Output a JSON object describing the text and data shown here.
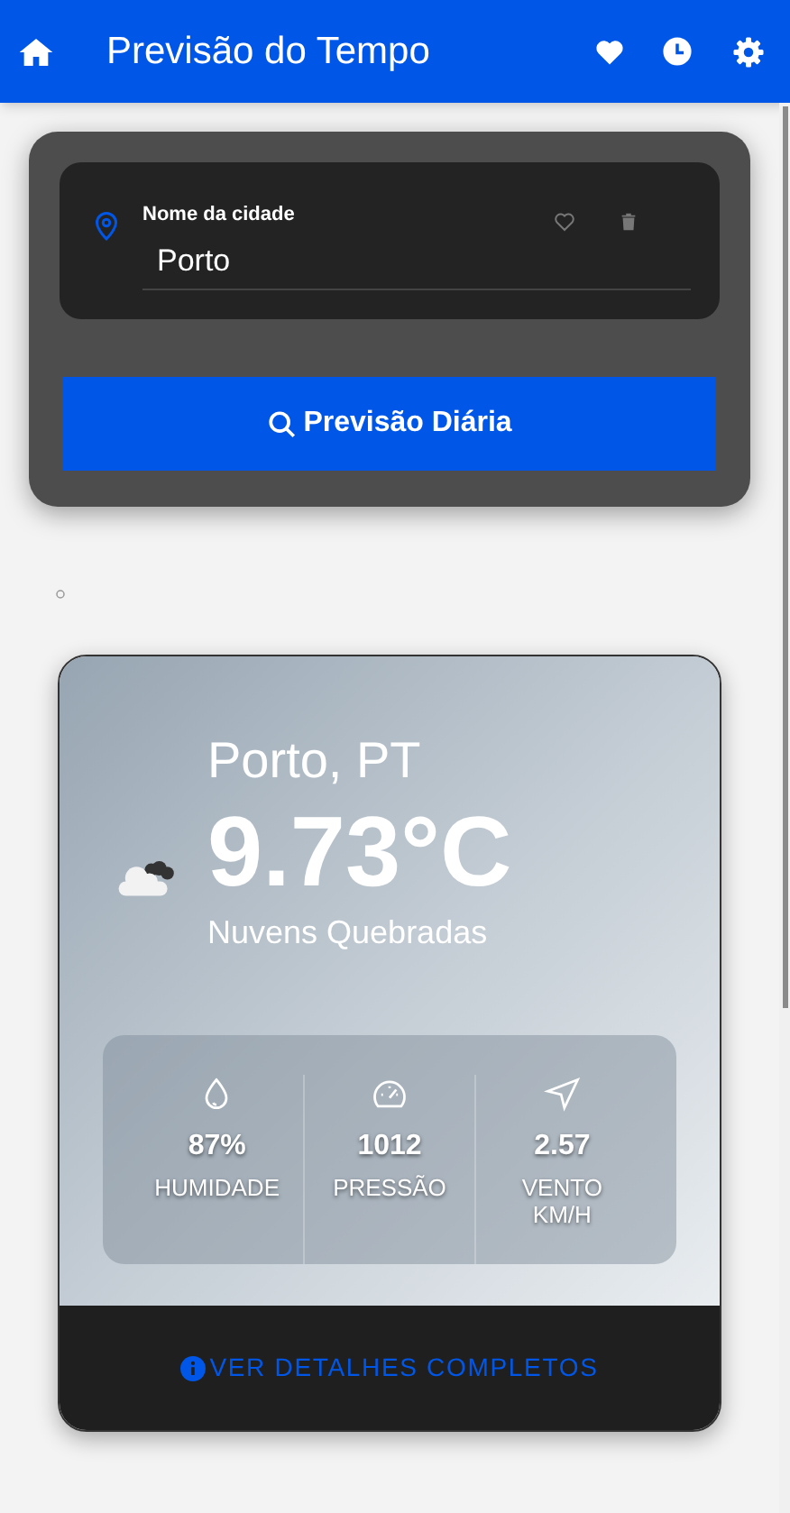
{
  "header": {
    "title": "Previsão do Tempo"
  },
  "search": {
    "label": "Nome da cidade",
    "value": "Porto",
    "button": "Previsão Diária"
  },
  "weather": {
    "location": "Porto, PT",
    "temperature": "9.73°C",
    "description": "Nuvens Quebradas",
    "stats": [
      {
        "kind": "humidity",
        "value": "87%",
        "label": "HUMIDADE"
      },
      {
        "kind": "pressure",
        "value": "1012",
        "label": "PRESSÃO"
      },
      {
        "kind": "wind",
        "value": "2.57",
        "label": "VENTO KM/H"
      }
    ],
    "details_button": "VER DETALHES COMPLETOS"
  }
}
